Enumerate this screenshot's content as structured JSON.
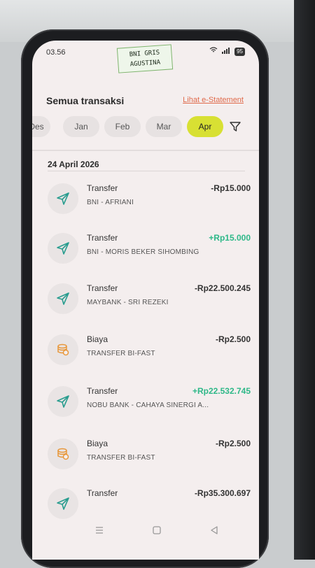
{
  "status": {
    "time": "03.56",
    "battery": "95"
  },
  "sticker": {
    "line1": "BNI GRIS",
    "line2": "AGUSTINA"
  },
  "header": {
    "title": "Semua transaksi",
    "statement_link": "Lihat e-Statement"
  },
  "months": [
    "Des",
    "Jan",
    "Feb",
    "Mar",
    "Apr"
  ],
  "selected_month": "Apr",
  "date_group": "24 April 2026",
  "transactions": [
    {
      "title": "Transfer",
      "subtitle": "BNI - AFRIANI",
      "amount": "-Rp15.000",
      "icon": "send-icon"
    },
    {
      "title": "Transfer",
      "subtitle": "BNI - MORIS BEKER SIHOMBING",
      "amount": "+Rp15.000",
      "icon": "send-icon"
    },
    {
      "title": "Transfer",
      "subtitle": "MAYBANK - SRI REZEKI",
      "amount": "-Rp22.500.245",
      "icon": "send-icon"
    },
    {
      "title": "Biaya",
      "subtitle": "TRANSFER BI-FAST",
      "amount": "-Rp2.500",
      "icon": "fee-icon"
    },
    {
      "title": "Transfer",
      "subtitle": "NOBU BANK - CAHAYA SINERGI A...",
      "amount": "+Rp22.532.745",
      "icon": "send-icon"
    },
    {
      "title": "Biaya",
      "subtitle": "TRANSFER BI-FAST",
      "amount": "-Rp2.500",
      "icon": "fee-icon"
    },
    {
      "title": "Transfer",
      "subtitle": "",
      "amount": "-Rp35.300.697",
      "icon": "send-icon"
    }
  ],
  "colors": {
    "accent_yellow": "#d8e033",
    "positive": "#2eb888",
    "link": "#e06a4b",
    "send_icon": "#2a9d8f",
    "fee_icon": "#e8973a"
  }
}
